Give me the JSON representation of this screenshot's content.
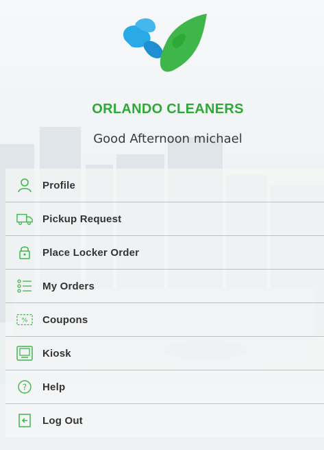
{
  "brand": {
    "name": "ORLANDO CLEANERS",
    "greeting": "Good Afternoon michael"
  },
  "colors": {
    "accent": "#2ea836",
    "logo_blue": "#29a9e6",
    "logo_green": "#3fb64a"
  },
  "menu": {
    "items": [
      {
        "label": "Profile",
        "icon": "person-icon"
      },
      {
        "label": "Pickup Request",
        "icon": "truck-icon"
      },
      {
        "label": "Place Locker Order",
        "icon": "lock-icon"
      },
      {
        "label": "My Orders",
        "icon": "list-icon"
      },
      {
        "label": "Coupons",
        "icon": "coupon-icon"
      },
      {
        "label": "Kiosk",
        "icon": "kiosk-icon"
      },
      {
        "label": "Help",
        "icon": "help-icon"
      },
      {
        "label": "Log Out",
        "icon": "logout-icon"
      }
    ]
  }
}
